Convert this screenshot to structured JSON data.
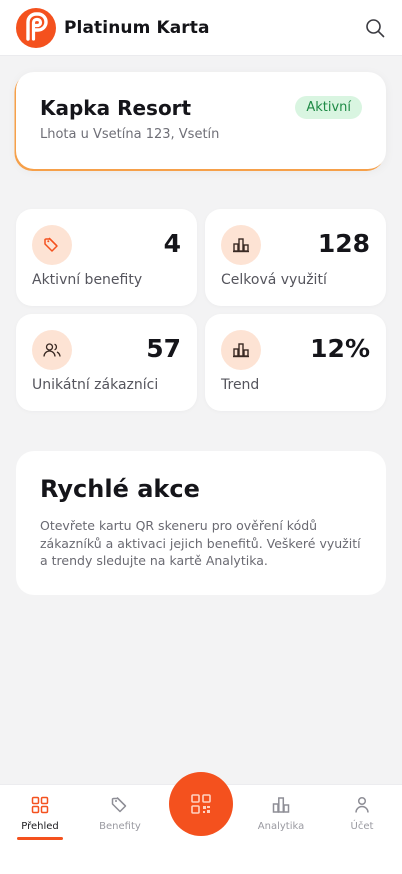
{
  "header": {
    "brand": "Platinum Karta",
    "accent": "#f4511e"
  },
  "location": {
    "name": "Kapka Resort",
    "address": "Lhota u Vsetína 123, Vsetín",
    "status": "Aktivní",
    "status_color": "#1e8a45"
  },
  "stats": [
    {
      "value": "4",
      "label": "Aktivní benefity",
      "icon": "tag-icon"
    },
    {
      "value": "128",
      "label": "Celková využití",
      "icon": "bar-chart-icon"
    },
    {
      "value": "57",
      "label": "Unikátní zákazníci",
      "icon": "users-icon"
    },
    {
      "value": "12%",
      "label": "Trend",
      "icon": "bar-chart-icon"
    }
  ],
  "quick_actions": {
    "title": "Rychlé akce",
    "text": "Otevřete kartu QR skeneru pro ověření kódů zákazníků a aktivaci jejich benefitů. Veškeré využití a trendy sledujte na kartě Analytika."
  },
  "nav": {
    "items": [
      {
        "label": "Přehled",
        "icon": "grid-icon",
        "active": true
      },
      {
        "label": "Benefity",
        "icon": "tag-icon",
        "active": false
      },
      {
        "label": "Analytika",
        "icon": "bar-chart-icon",
        "active": false
      },
      {
        "label": "Účet",
        "icon": "user-icon",
        "active": false
      }
    ],
    "scan_icon": "qr-scan-icon"
  }
}
